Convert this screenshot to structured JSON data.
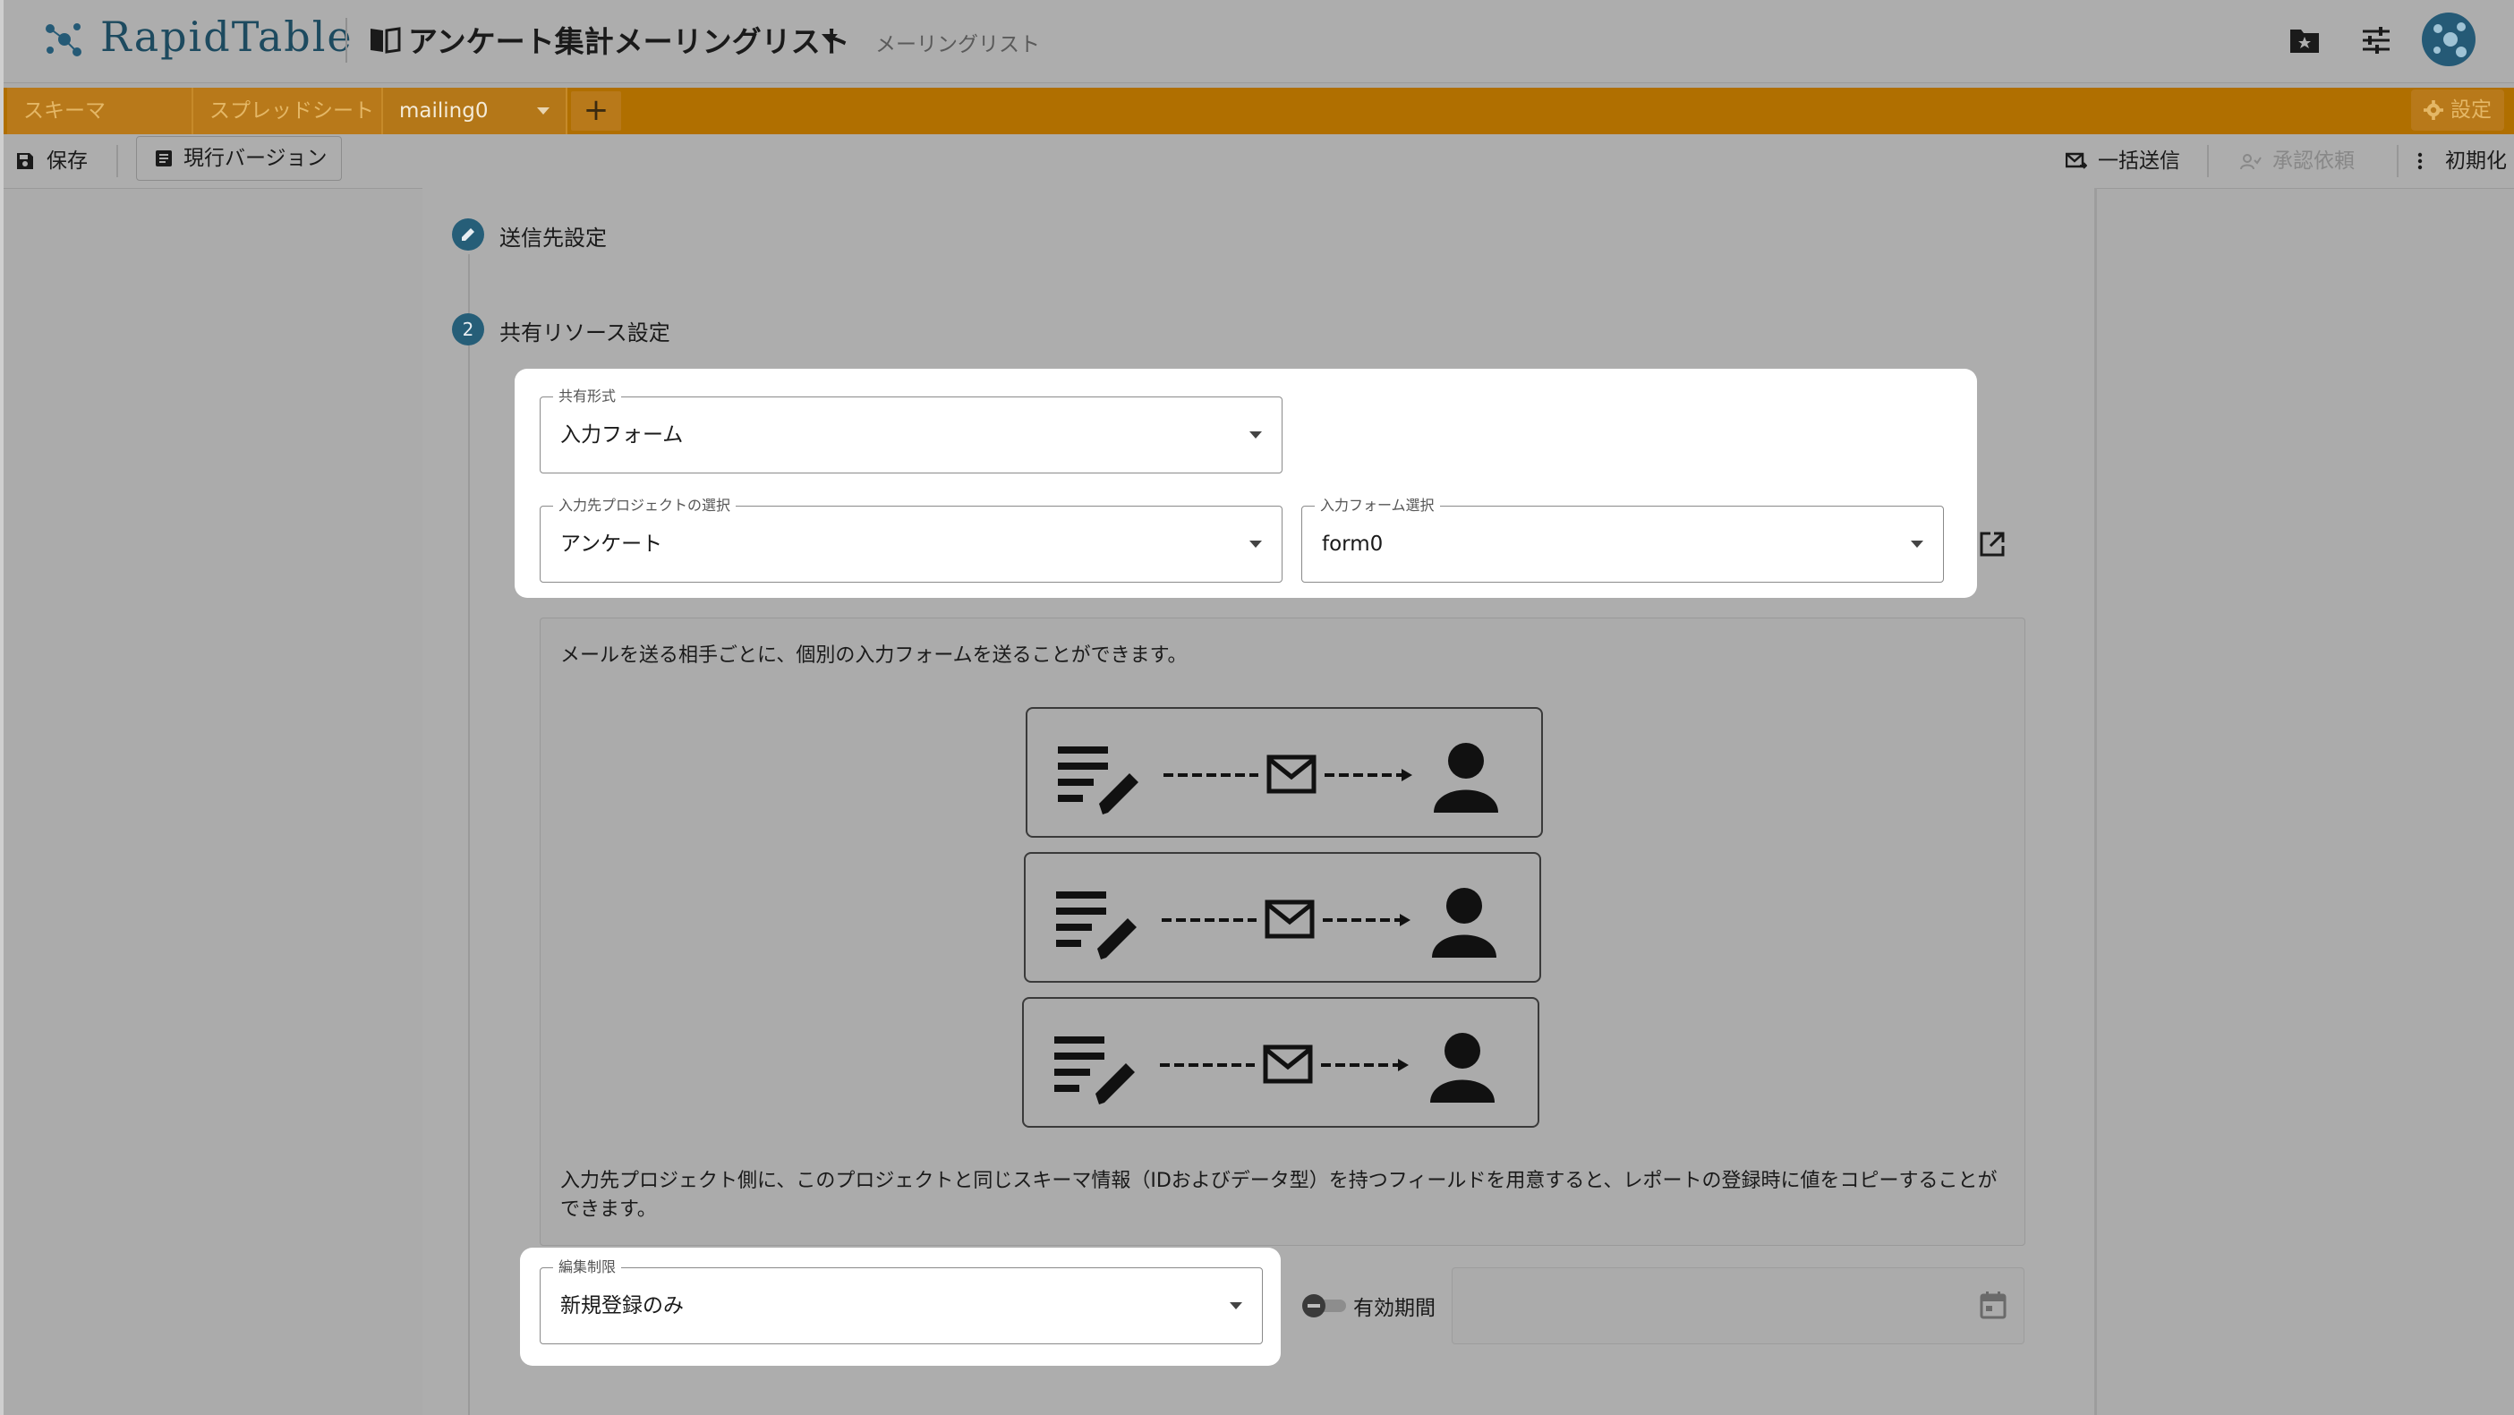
{
  "header": {
    "logo_text": "RapidTable",
    "project_title": "アンケート集計メーリングリスト",
    "project_subtitle": "メーリングリスト",
    "icons": [
      "logo-icon",
      "book-icon",
      "folder-star-icon",
      "tune-icon",
      "share-avatar-icon"
    ]
  },
  "tabs": [
    {
      "label": "スキーマ"
    },
    {
      "label": "スプレッドシート"
    },
    {
      "label": "mailing0",
      "active": true
    }
  ],
  "tab_add_label": "+",
  "settings_label": "設定",
  "toolbar": {
    "save_label": "保存",
    "version_label": "現行バージョン",
    "bulk_send_label": "一括送信",
    "approval_label": "承認依頼",
    "init_label": "初期化"
  },
  "stepper": {
    "step1_label": "送信先設定",
    "step2_number": "2",
    "step2_label": "共有リソース設定"
  },
  "form": {
    "share_type": {
      "label": "共有形式",
      "value": "入力フォーム"
    },
    "project": {
      "label": "入力先プロジェクトの選択",
      "value": "アンケート"
    },
    "input_form": {
      "label": "入力フォーム選択",
      "value": "form0"
    },
    "edit_limit": {
      "label": "編集制限",
      "value": "新規登録のみ"
    },
    "validity_label": "有効期間",
    "validity_enabled": false
  },
  "info": {
    "text1": "メールを送る相手ごとに、個別の入力フォームを送ることができます。",
    "text2": "入力先プロジェクト側に、このプロジェクトと同じスキーマ情報（IDおよびデータ型）を持つフィールドを用意すると、レポートの登録時に値をコピーすることができます。"
  },
  "colors": {
    "accent": "#265e78",
    "tab_bar": "#b06f00",
    "overlay_bg": "#ababab",
    "highlight": "#ffffff"
  }
}
